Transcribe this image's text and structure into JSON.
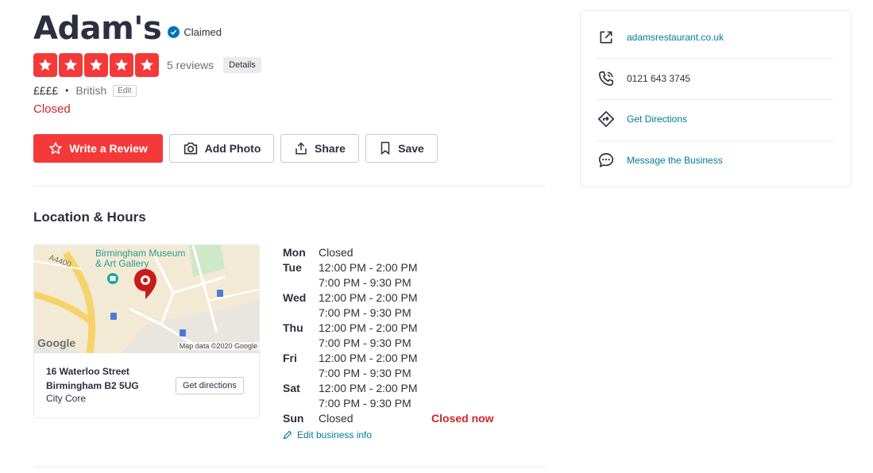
{
  "business": {
    "name": "Adam's",
    "claimed_label": "Claimed",
    "rating": 5,
    "rating_max": 5,
    "reviews_label": "5 reviews",
    "details_label": "Details",
    "price": "££££",
    "separator": "•",
    "category": "British",
    "edit_label": "Edit",
    "status": "Closed"
  },
  "actions": {
    "write_review": "Write a Review",
    "add_photo": "Add Photo",
    "share": "Share",
    "save": "Save"
  },
  "location": {
    "section_title": "Location & Hours",
    "address_line1": "16 Waterloo Street",
    "address_line2": "Birmingham B2 5UG",
    "area": "City Core",
    "directions_button": "Get directions",
    "map": {
      "label_museum_1": "Birmingham Museum",
      "label_museum_2": "& Art Gallery",
      "label_road": "A4400",
      "attribution": "Map data ©2020 Google",
      "logo": "Google"
    }
  },
  "hours": [
    {
      "day": "Mon",
      "times": [
        "Closed"
      ]
    },
    {
      "day": "Tue",
      "times": [
        "12:00 PM - 2:00 PM",
        "7:00 PM - 9:30 PM"
      ]
    },
    {
      "day": "Wed",
      "times": [
        "12:00 PM - 2:00 PM",
        "7:00 PM - 9:30 PM"
      ]
    },
    {
      "day": "Thu",
      "times": [
        "12:00 PM - 2:00 PM",
        "7:00 PM - 9:30 PM"
      ]
    },
    {
      "day": "Fri",
      "times": [
        "12:00 PM - 2:00 PM",
        "7:00 PM - 9:30 PM"
      ]
    },
    {
      "day": "Sat",
      "times": [
        "12:00 PM - 2:00 PM",
        "7:00 PM - 9:30 PM"
      ]
    },
    {
      "day": "Sun",
      "times": [
        "Closed"
      ],
      "note": "Closed now"
    }
  ],
  "edit_business_info": "Edit business info",
  "sidebar": {
    "website": "adamsrestaurant.co.uk",
    "phone": "0121 643 3745",
    "directions": "Get Directions",
    "message": "Message the Business"
  },
  "colors": {
    "brand_red": "#f43939",
    "link_teal": "#027a97",
    "closed_red": "#d32323",
    "verified_blue": "#0073bb"
  }
}
